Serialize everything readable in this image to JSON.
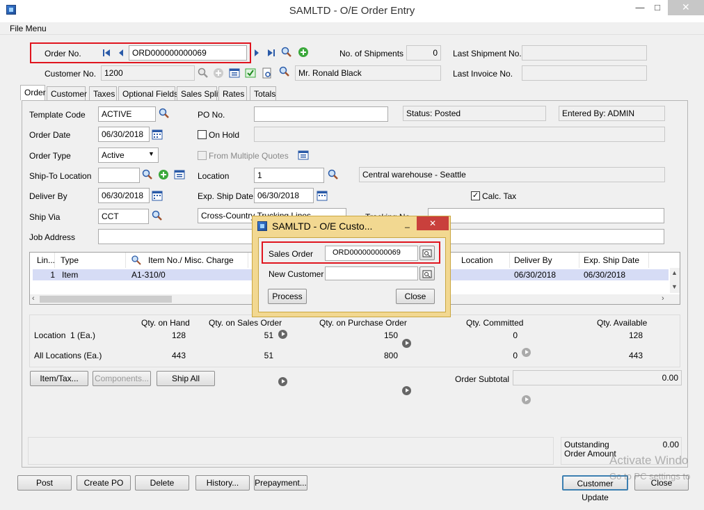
{
  "window": {
    "title": "SAMLTD - O/E Order Entry",
    "minimize": "—",
    "maximize": "□",
    "close": "✕"
  },
  "menu": {
    "file": "File Menu"
  },
  "header": {
    "order_no_label": "Order No.",
    "order_no_value": "ORD000000000069",
    "shipments_label": "No. of Shipments",
    "shipments_value": "0",
    "last_shipment_label": "Last Shipment No.",
    "last_shipment_value": "",
    "customer_no_label": "Customer No.",
    "customer_no_value": "1200",
    "customer_name": "Mr. Ronald Black",
    "last_invoice_label": "Last Invoice No.",
    "last_invoice_value": ""
  },
  "tabs": [
    "Order",
    "Customer",
    "Taxes",
    "Optional Fields",
    "Sales Split",
    "Rates",
    "Totals"
  ],
  "order_tab": {
    "template_code_label": "Template Code",
    "template_code_value": "ACTIVE",
    "po_no_label": "PO No.",
    "po_no_value": "",
    "status": "Status: Posted",
    "entered_by": "Entered By: ADMIN",
    "order_date_label": "Order Date",
    "order_date_value": "06/30/2018",
    "on_hold_label": "On Hold",
    "order_type_label": "Order Type",
    "order_type_value": "Active",
    "multiple_quotes_label": "From Multiple Quotes",
    "ship_to_label": "Ship-To Location",
    "ship_to_value": "",
    "location_label": "Location",
    "location_value": "1",
    "location_desc": "Central warehouse - Seattle",
    "deliver_by_label": "Deliver By",
    "deliver_by_value": "06/30/2018",
    "exp_ship_label": "Exp. Ship Date",
    "exp_ship_value": "06/30/2018",
    "calc_tax_label": "Calc. Tax",
    "calc_tax_checked": true,
    "ship_via_label": "Ship Via",
    "ship_via_value": "CCT",
    "ship_via_desc": "Cross-Country Trucking Lines",
    "tracking_label": "Tracking No.",
    "job_address_label": "Job Address"
  },
  "grid": {
    "columns": [
      "Lin...",
      "Type",
      "Item No./ Misc. Charge",
      "Location",
      "Deliver By",
      "Exp. Ship Date"
    ],
    "rows": [
      {
        "line": "1",
        "type": "Item",
        "item": "A1-310/0",
        "location": "",
        "deliver_by": "06/30/2018",
        "exp_ship": "06/30/2018"
      }
    ]
  },
  "stock": {
    "headers": [
      "Qty. on Hand",
      "Qty. on Sales Order",
      "Qty. on Purchase Order",
      "Qty. Committed",
      "Qty. Available"
    ],
    "rows": [
      {
        "label": "Location  1 (Ea.)",
        "on_hand": "128",
        "on_so": "51",
        "on_po": "150",
        "committed": "0",
        "available": "128"
      },
      {
        "label": "All Locations (Ea.)",
        "on_hand": "443",
        "on_so": "51",
        "on_po": "800",
        "committed": "0",
        "available": "443"
      }
    ]
  },
  "row_buttons": {
    "item_tax": "Item/Tax...",
    "components": "Components...",
    "ship_all": "Ship All"
  },
  "totals": {
    "subtotal_label": "Order Subtotal",
    "subtotal_value": "0.00",
    "outstanding_label_1": "Outstanding",
    "outstanding_label_2": "Order Amount",
    "outstanding_value": "0.00"
  },
  "footer_buttons": {
    "post": "Post",
    "create_po": "Create PO",
    "delete": "Delete",
    "history": "History...",
    "prepayment": "Prepayment...",
    "customer_update": "Customer Update",
    "close": "Close"
  },
  "watermark": {
    "line1": "Activate Windo",
    "line2": "Go to PC settings to"
  },
  "dialog": {
    "title": "SAMLTD - O/E Custo...",
    "sales_order_label": "Sales Order",
    "sales_order_value": "ORD000000000069",
    "new_customer_label": "New Customer",
    "new_customer_value": "",
    "process": "Process",
    "close": "Close"
  },
  "colors": {
    "highlight": "#e0141e",
    "selected_row": "#d6dcf5",
    "dialog_frame": "#f2d891"
  }
}
